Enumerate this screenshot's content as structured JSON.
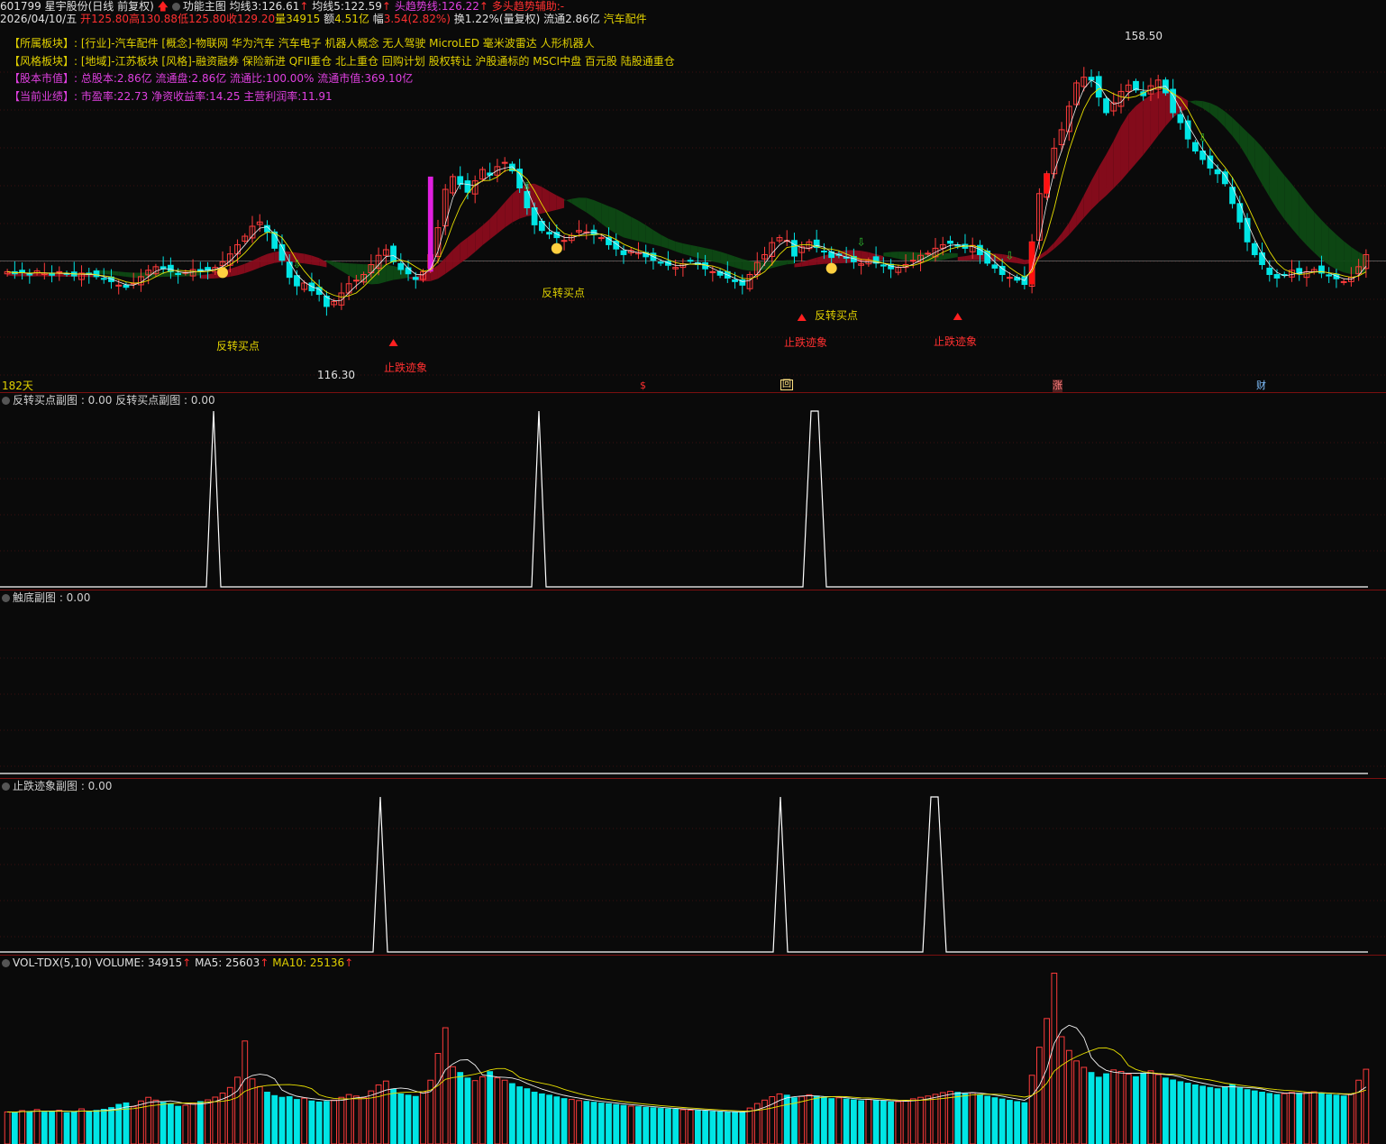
{
  "header": {
    "code_name": "601799 星宇股份(日线 前复权)",
    "indicator_name": "功能主图",
    "ma3_label": "均线3:",
    "ma3_value": "126.61",
    "ma5_label": "均线5:",
    "ma5_value": "122.59",
    "head_trend_label": "头趋势线:",
    "head_trend_value": "126.22",
    "bull_aux_label": "多头趋势辅助:",
    "bull_aux_value": "-",
    "date": "2026/04/10/五",
    "open_label": "开",
    "open": "125.80",
    "high_label": "高",
    "high": "130.88",
    "low_label": "低",
    "low": "125.80",
    "close_label": "收",
    "close": "129.20",
    "vol_label": "量",
    "vol": "34915",
    "amount_label": "额",
    "amount": "4.51亿",
    "change_label": "幅",
    "change": "3.54(2.82%)",
    "turnover": "换1.22%(量复权)",
    "float": "流通2.86亿",
    "sector": "汽车配件"
  },
  "info": {
    "industry_key": "【所属板块】:",
    "industry_val": "[行业]-汽车配件 [概念]-物联网 华为汽车 汽车电子 机器人概念 无人驾驶 MicroLED 毫米波雷达 人形机器人",
    "style_key": "【风格板块】:",
    "style_val": "[地域]-江苏板块 [风格]-融资融券 保险新进 QFII重仓 北上重仓 回购计划 股权转让 沪股通标的 MSCI中盘 百元股 陆股通重仓",
    "cap_key": "【股本市值】:",
    "cap_val": "总股本:2.86亿 流通盘:2.86亿 流通比:100.00% 流通市值:369.10亿",
    "perf_key": "【当前业绩】:",
    "perf_val": "市盈率:22.73 净资收益率:14.25 主营利润率:11.91"
  },
  "main_chart": {
    "high_marker": "158.50",
    "low_marker": "116.30",
    "days_label": "182天",
    "signals": {
      "reversal_buy": "反转买点",
      "stop_fall": "止跌迹象"
    },
    "event_tags": [
      "$",
      "回",
      "涨",
      "财"
    ]
  },
  "panels": {
    "reversal_label": "反转买点副图 : 0.00  反转买点副图 : 0.00",
    "touch_label": "触底副图 : 0.00",
    "stopfall_label": "止跌迹象副图 : 0.00",
    "vol_name": "VOL-TDX(5,10)",
    "vol_volume_label": "VOLUME:",
    "vol_volume": "34915",
    "vol_ma5_label": "MA5:",
    "vol_ma5": "25603",
    "vol_ma10_label": "MA10:",
    "vol_ma10": "25136"
  },
  "chart_data": {
    "type": "candlestick",
    "closes": [
      126.8,
      126.5,
      126.7,
      126.4,
      126.9,
      126.6,
      126.3,
      126.8,
      126.5,
      126.2,
      126.6,
      126.4,
      126.1,
      125.8,
      125.4,
      124.9,
      124.6,
      125.2,
      126.1,
      127.0,
      127.5,
      127.2,
      126.8,
      126.4,
      126.7,
      127.1,
      126.9,
      127.0,
      127.4,
      128.2,
      129.3,
      130.6,
      131.8,
      133.2,
      133.8,
      132.4,
      130.1,
      128.4,
      126.0,
      124.8,
      125.2,
      124.1,
      123.6,
      121.9,
      122.6,
      123.8,
      125.1,
      125.6,
      126.4,
      127.8,
      129.1,
      129.9,
      128.2,
      127.1,
      126.5,
      125.7,
      126.8,
      129.2,
      133.0,
      138.4,
      140.2,
      139.1,
      138.0,
      139.6,
      141.2,
      140.4,
      141.6,
      142.2,
      141.0,
      138.6,
      135.8,
      133.4,
      132.6,
      132.1,
      131.6,
      131.2,
      131.9,
      132.6,
      132.4,
      132.0,
      131.6,
      130.6,
      130.0,
      129.2,
      129.8,
      129.5,
      128.9,
      128.4,
      128.0,
      127.7,
      127.4,
      127.9,
      128.3,
      127.8,
      127.2,
      126.8,
      126.3,
      125.9,
      125.4,
      124.9,
      126.4,
      128.1,
      129.2,
      130.9,
      131.6,
      131.2,
      129.0,
      130.3,
      131.0,
      130.2,
      129.6,
      128.8,
      129.1,
      128.7,
      128.2,
      127.9,
      128.4,
      128.0,
      127.6,
      127.2,
      127.4,
      127.8,
      128.4,
      129.1,
      129.4,
      130.1,
      130.6,
      130.8,
      130.4,
      130.1,
      130.5,
      129.2,
      128.0,
      127.3,
      126.4,
      126.0,
      125.6,
      125.0,
      131.0,
      137.8,
      140.6,
      144.2,
      146.8,
      150.1,
      153.4,
      154.2,
      153.8,
      151.4,
      149.2,
      150.6,
      152.2,
      153.1,
      152.4,
      151.6,
      153.0,
      153.8,
      152.0,
      149.2,
      147.8,
      145.5,
      143.8,
      142.6,
      141.4,
      140.6,
      139.2,
      136.4,
      133.8,
      131.0,
      129.2,
      127.8,
      126.4,
      125.9,
      126.3,
      127.0,
      126.5,
      126.8,
      127.1,
      126.6,
      126.2,
      125.8,
      125.4,
      126.0,
      127.5,
      129.2
    ],
    "volumes": [
      15000,
      14800,
      15600,
      15200,
      16100,
      14900,
      15300,
      15800,
      14600,
      15100,
      16400,
      15000,
      15700,
      16200,
      17000,
      18500,
      19200,
      17400,
      20100,
      21800,
      20500,
      19400,
      18800,
      17600,
      18100,
      19000,
      19800,
      20600,
      21900,
      23800,
      26400,
      31200,
      48100,
      30400,
      26800,
      24200,
      22600,
      21800,
      22100,
      20800,
      21400,
      20100,
      19600,
      19900,
      20500,
      21800,
      23100,
      22400,
      21600,
      24800,
      27600,
      29400,
      25600,
      23400,
      22800,
      22200,
      24400,
      29800,
      42300,
      54300,
      36100,
      33400,
      30800,
      29600,
      31400,
      33800,
      30900,
      29800,
      28200,
      26700,
      25800,
      24200,
      23400,
      22800,
      22000,
      21200,
      20800,
      20300,
      19900,
      19500,
      19100,
      18800,
      18400,
      18000,
      17700,
      17400,
      17100,
      16900,
      16600,
      16400,
      16200,
      16000,
      15800,
      15600,
      15400,
      15200,
      15000,
      14900,
      14800,
      14700,
      16800,
      18900,
      20500,
      22100,
      23400,
      22800,
      21600,
      22200,
      23000,
      22400,
      21800,
      21200,
      21600,
      21000,
      20600,
      20200,
      20800,
      20400,
      20000,
      19600,
      19800,
      20300,
      21100,
      21800,
      22400,
      23200,
      24000,
      24600,
      24100,
      23500,
      23900,
      23000,
      22300,
      21600,
      21000,
      20400,
      19800,
      19300,
      32100,
      45200,
      58600,
      79800,
      50100,
      43700,
      38800,
      35800,
      33400,
      31200,
      32800,
      34600,
      33900,
      32600,
      31400,
      33100,
      34200,
      32400,
      30800,
      29900,
      29100,
      28400,
      27600,
      27000,
      26400,
      25800,
      26600,
      27800,
      26200,
      25400,
      24800,
      24200,
      23600,
      23100,
      23500,
      24100,
      23700,
      23900,
      24400,
      23600,
      23100,
      22800,
      22400,
      23300,
      29800,
      34915
    ]
  }
}
